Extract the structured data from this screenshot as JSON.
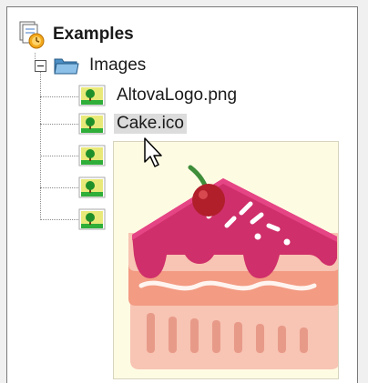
{
  "tree": {
    "root": {
      "label": "Examples",
      "icon": "project-folder-icon"
    },
    "folder": {
      "label": "Images",
      "icon": "folder-icon",
      "expanded": true
    },
    "files": [
      {
        "label": "AltovaLogo.png",
        "icon": "image-file-icon"
      },
      {
        "label": "Cake.ico",
        "icon": "image-file-icon",
        "hovered": true
      },
      {
        "label": "",
        "icon": "image-file-icon"
      },
      {
        "label": "",
        "icon": "image-file-icon"
      },
      {
        "label": "",
        "icon": "image-file-icon"
      }
    ]
  },
  "preview": {
    "icon": "cake-slice-icon"
  },
  "colors": {
    "cake_icing": "#cf2f6a",
    "cake_sponge": "#f6b3a0",
    "cake_cream": "#fde2d6",
    "preview_bg": "#fefbe3",
    "hover_bg": "#dcdcdc"
  }
}
